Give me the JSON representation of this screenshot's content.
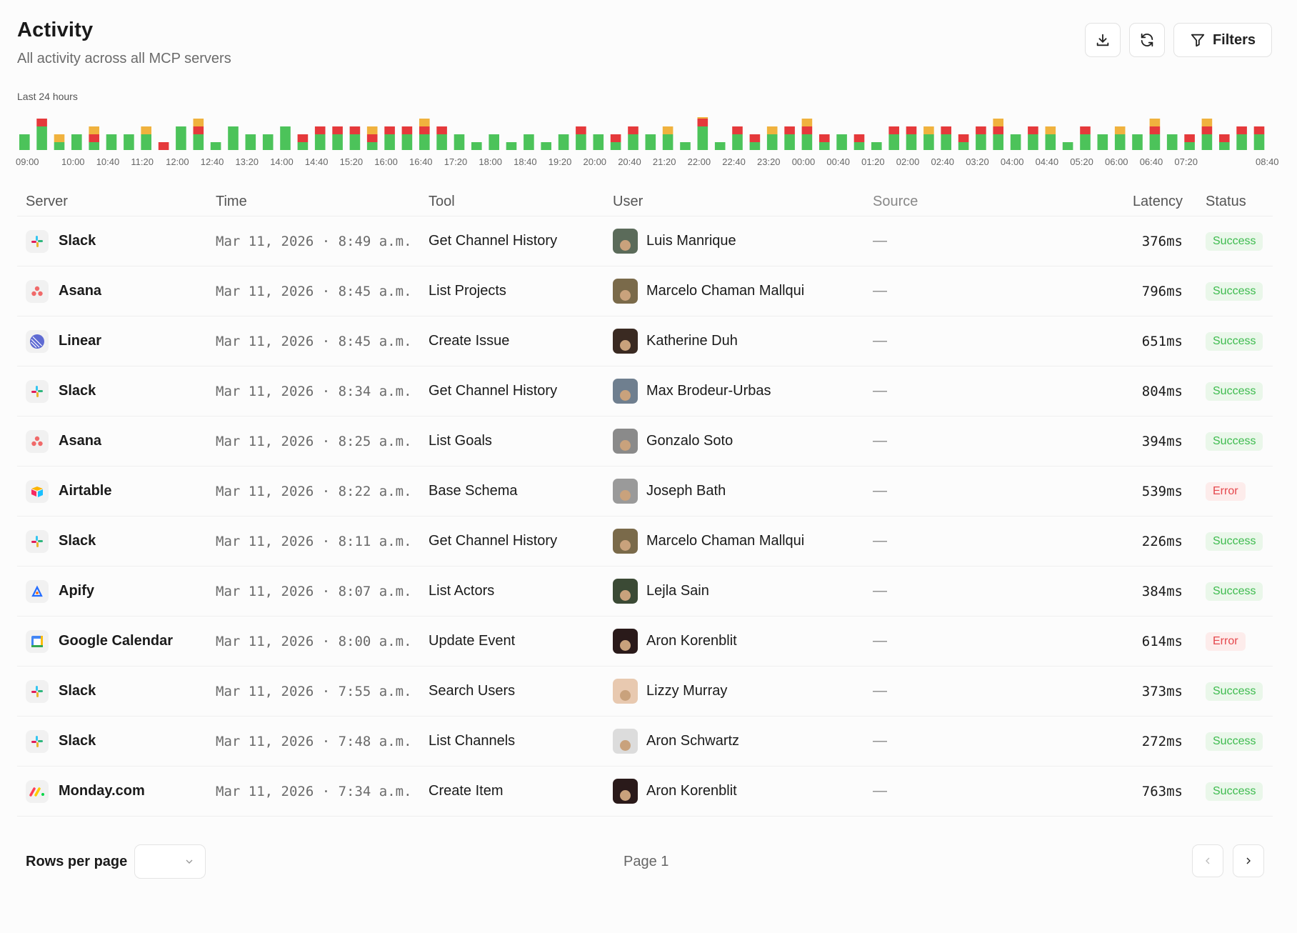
{
  "header": {
    "title": "Activity",
    "subtitle": "All activity across all MCP servers",
    "filters_label": "Filters"
  },
  "chart_data": {
    "type": "bar",
    "stacked": true,
    "title": "Last 24 hours",
    "tick_labels": [
      "09:00",
      "10:00",
      "10:40",
      "11:20",
      "12:00",
      "12:40",
      "13:20",
      "14:00",
      "14:40",
      "15:20",
      "16:00",
      "16:40",
      "17:20",
      "18:00",
      "18:40",
      "19:20",
      "20:00",
      "20:40",
      "21:20",
      "22:00",
      "22:40",
      "23:20",
      "00:00",
      "00:40",
      "01:20",
      "02:00",
      "02:40",
      "03:20",
      "04:00",
      "04:40",
      "05:20",
      "06:00",
      "06:40",
      "07:20",
      "08:40"
    ],
    "series": [
      {
        "color": "#4cc35a",
        "values": [
          2,
          3,
          1,
          2,
          1,
          2,
          2,
          2,
          0,
          3,
          2,
          1,
          3,
          2,
          2,
          3,
          1,
          2,
          2,
          2,
          1,
          2,
          2,
          2,
          2,
          2,
          1,
          2,
          1,
          2,
          1,
          2,
          2,
          2,
          1,
          2,
          2,
          2,
          1,
          3,
          1,
          2,
          1,
          2,
          2,
          2,
          1,
          2,
          1,
          1,
          2,
          2,
          2,
          2,
          1,
          2,
          2,
          2,
          2,
          2,
          1,
          2,
          2,
          2,
          2,
          2,
          2,
          1,
          2,
          1,
          2,
          2
        ]
      },
      {
        "color": "#e5393b",
        "values": [
          0,
          1,
          0,
          0,
          1,
          0,
          0,
          0,
          1,
          0,
          1,
          0,
          0,
          0,
          0,
          0,
          1,
          1,
          1,
          1,
          1,
          1,
          1,
          1,
          1,
          0,
          0,
          0,
          0,
          0,
          0,
          0,
          1,
          0,
          1,
          1,
          0,
          0,
          0,
          1,
          0,
          1,
          1,
          0,
          1,
          1,
          1,
          0,
          1,
          0,
          1,
          1,
          0,
          1,
          1,
          1,
          1,
          0,
          1,
          0,
          0,
          1,
          0,
          0,
          0,
          1,
          0,
          1,
          1,
          1,
          1,
          1
        ]
      },
      {
        "color": "#f0b23e",
        "values": [
          0,
          0,
          1,
          0,
          1,
          0,
          0,
          1,
          0,
          0,
          1,
          0,
          0,
          0,
          0,
          0,
          0,
          0,
          0,
          0,
          1,
          0,
          0,
          1,
          0,
          0,
          0,
          0,
          0,
          0,
          0,
          0,
          0,
          0,
          0,
          0,
          0,
          1,
          0,
          1,
          0,
          0,
          0,
          1,
          0,
          1,
          0,
          0,
          0,
          0,
          0,
          0,
          1,
          0,
          0,
          0,
          1,
          0,
          0,
          1,
          0,
          0,
          0,
          1,
          0,
          1,
          0,
          0,
          1,
          0,
          0,
          0
        ]
      }
    ]
  },
  "table": {
    "columns": {
      "server": "Server",
      "time": "Time",
      "tool": "Tool",
      "user": "User",
      "source": "Source",
      "latency": "Latency",
      "status": "Status"
    },
    "rows": [
      {
        "server": "Slack",
        "icon": "slack-icon",
        "time": "Mar 11, 2026 · 8:49 a.m.",
        "tool": "Get Channel History",
        "user": "Luis Manrique",
        "avatar_bg": "#5b6b5a",
        "source": "—",
        "latency": "376ms",
        "status": "Success",
        "status_kind": "ok"
      },
      {
        "server": "Asana",
        "icon": "asana-icon",
        "time": "Mar 11, 2026 · 8:45 a.m.",
        "tool": "List Projects",
        "user": "Marcelo Chaman Mallqui",
        "avatar_bg": "#7a6a4a",
        "source": "—",
        "latency": "796ms",
        "status": "Success",
        "status_kind": "ok"
      },
      {
        "server": "Linear",
        "icon": "linear-icon",
        "time": "Mar 11, 2026 · 8:45 a.m.",
        "tool": "Create Issue",
        "user": "Katherine Duh",
        "avatar_bg": "#3a2a22",
        "source": "—",
        "latency": "651ms",
        "status": "Success",
        "status_kind": "ok"
      },
      {
        "server": "Slack",
        "icon": "slack-icon",
        "time": "Mar 11, 2026 · 8:34 a.m.",
        "tool": "Get Channel History",
        "user": "Max Brodeur-Urbas",
        "avatar_bg": "#6f7f8f",
        "source": "—",
        "latency": "804ms",
        "status": "Success",
        "status_kind": "ok"
      },
      {
        "server": "Asana",
        "icon": "asana-icon",
        "time": "Mar 11, 2026 · 8:25 a.m.",
        "tool": "List Goals",
        "user": "Gonzalo Soto",
        "avatar_bg": "#8a8a8a",
        "source": "—",
        "latency": "394ms",
        "status": "Success",
        "status_kind": "ok"
      },
      {
        "server": "Airtable",
        "icon": "airtable-icon",
        "time": "Mar 11, 2026 · 8:22 a.m.",
        "tool": "Base Schema",
        "user": "Joseph Bath",
        "avatar_bg": "#9a9a9a",
        "source": "—",
        "latency": "539ms",
        "status": "Error",
        "status_kind": "err"
      },
      {
        "server": "Slack",
        "icon": "slack-icon",
        "time": "Mar 11, 2026 · 8:11 a.m.",
        "tool": "Get Channel History",
        "user": "Marcelo Chaman Mallqui",
        "avatar_bg": "#7a6a4a",
        "source": "—",
        "latency": "226ms",
        "status": "Success",
        "status_kind": "ok"
      },
      {
        "server": "Apify",
        "icon": "apify-icon",
        "time": "Mar 11, 2026 · 8:07 a.m.",
        "tool": "List Actors",
        "user": "Lejla Sain",
        "avatar_bg": "#3b4a35",
        "source": "—",
        "latency": "384ms",
        "status": "Success",
        "status_kind": "ok"
      },
      {
        "server": "Google Calendar",
        "icon": "google-calendar-icon",
        "time": "Mar 11, 2026 · 8:00 a.m.",
        "tool": "Update Event",
        "user": "Aron Korenblit",
        "avatar_bg": "#2a1a1a",
        "source": "—",
        "latency": "614ms",
        "status": "Error",
        "status_kind": "err"
      },
      {
        "server": "Slack",
        "icon": "slack-icon",
        "time": "Mar 11, 2026 · 7:55 a.m.",
        "tool": "Search Users",
        "user": "Lizzy Murray",
        "avatar_bg": "#e8c9b0",
        "source": "—",
        "latency": "373ms",
        "status": "Success",
        "status_kind": "ok"
      },
      {
        "server": "Slack",
        "icon": "slack-icon",
        "time": "Mar 11, 2026 · 7:48 a.m.",
        "tool": "List Channels",
        "user": "Aron Schwartz",
        "avatar_bg": "#dcdcdc",
        "source": "—",
        "latency": "272ms",
        "status": "Success",
        "status_kind": "ok"
      },
      {
        "server": "Monday.com",
        "icon": "monday-icon",
        "time": "Mar 11, 2026 · 7:34 a.m.",
        "tool": "Create Item",
        "user": "Aron Korenblit",
        "avatar_bg": "#2a1a1a",
        "source": "—",
        "latency": "763ms",
        "status": "Success",
        "status_kind": "ok"
      }
    ]
  },
  "footer": {
    "rows_per_page_label": "Rows per page",
    "page_label": "Page 1"
  }
}
